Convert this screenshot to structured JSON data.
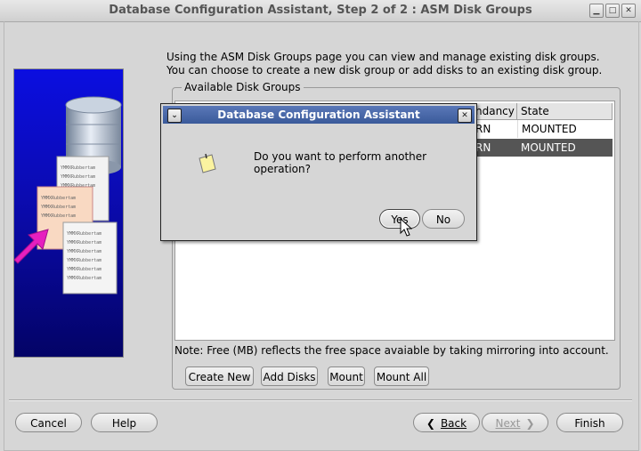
{
  "window": {
    "title": "Database Configuration Assistant, Step 2 of 2 : ASM Disk Groups",
    "minimize_glyph": "▁",
    "restore_glyph": "□",
    "close_glyph": "✕"
  },
  "sidebar_image": {
    "document_text": "YMMXRubbertam",
    "icon": "database-documents-illustration"
  },
  "description": "Using the ASM Disk Groups page you can view and manage existing disk groups. You can choose to create a new disk group or add disks to an existing disk group.",
  "disk_groups": {
    "label": "Available Disk Groups",
    "columns": [
      "ndancy",
      "State"
    ],
    "rows": [
      {
        "redundancy": "RN",
        "state": "MOUNTED",
        "selected": false
      },
      {
        "redundancy": "RN",
        "state": "MOUNTED",
        "selected": true
      }
    ],
    "note": "Note: Free (MB) reflects the free space avaiable by taking mirroring into account.",
    "buttons": {
      "create_new": "Create New",
      "add_disks": "Add Disks",
      "mount": "Mount",
      "mount_all": "Mount All"
    }
  },
  "footer": {
    "cancel": "Cancel",
    "help": "Help",
    "back": "Back",
    "next": "Next",
    "finish": "Finish"
  },
  "dialog": {
    "title": "Database Configuration Assistant",
    "message": "Do you want to perform another operation?",
    "yes": "Yes",
    "no": "No",
    "menu_glyph": "⌄",
    "close_glyph": "✕",
    "icon": "note-icon"
  },
  "colors": {
    "window_bg": "#d6d6d6",
    "dialog_title_bg": "#4a6aa8",
    "selected_row_bg": "#555555",
    "sidebar_blue": "#0b0ee0"
  }
}
